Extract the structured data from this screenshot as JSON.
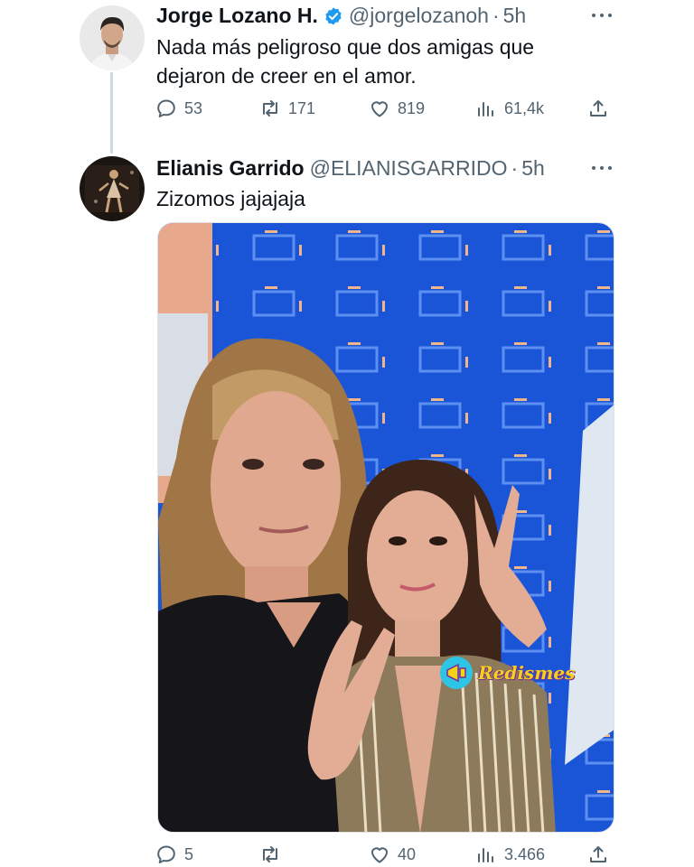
{
  "tweet1": {
    "name": "Jorge Lozano H.",
    "handle": "@jorgelozanoh",
    "separator": "·",
    "time": "5h",
    "text_line1": "Nada más peligroso que dos amigas que",
    "text_line2": "dejaron de creer en el amor.",
    "replies": "53",
    "retweets": "171",
    "likes": "819",
    "views": "61,4k",
    "verified": true
  },
  "tweet2": {
    "name": "Elianis Garrido",
    "handle": "@ELIANISGARRIDO",
    "separator": "·",
    "time": "5h",
    "text": "Zizomos jajajaja",
    "replies": "5",
    "retweets": "",
    "likes": "40",
    "views": "3.466"
  },
  "media": {
    "watermark_text": "Redismes"
  },
  "colors": {
    "text": "#0f1419",
    "secondary": "#536471",
    "verified": "#1d9bf0",
    "thread_line": "#cfd9de"
  },
  "icons": {
    "reply": "reply-icon",
    "retweet": "retweet-icon",
    "like": "heart-icon",
    "views": "views-icon",
    "share": "share-icon",
    "more": "more-icon"
  }
}
